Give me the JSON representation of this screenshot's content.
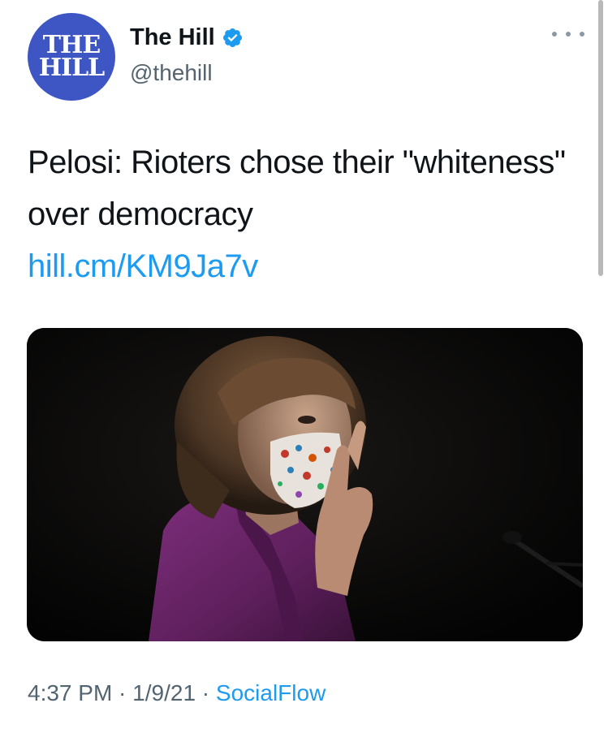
{
  "author": {
    "avatar_text": "THE\nHILL",
    "display_name": "The Hill",
    "handle": "@thehill",
    "verified": true
  },
  "tweet": {
    "text": "Pelosi: Rioters chose their \"whiteness\" over democracy",
    "link": "hill.cm/KM9Ja7v"
  },
  "meta": {
    "time": "4:37 PM",
    "separator_1": " · ",
    "date": "1/9/21",
    "separator_2": " · ",
    "source": "SocialFlow"
  },
  "icons": {
    "verified": "verified-badge-icon",
    "more": "more-options-icon"
  },
  "colors": {
    "avatar_bg": "#3d56c4",
    "link": "#1d9bf0",
    "secondary_text": "#536471",
    "verified": "#1d9bf0"
  }
}
